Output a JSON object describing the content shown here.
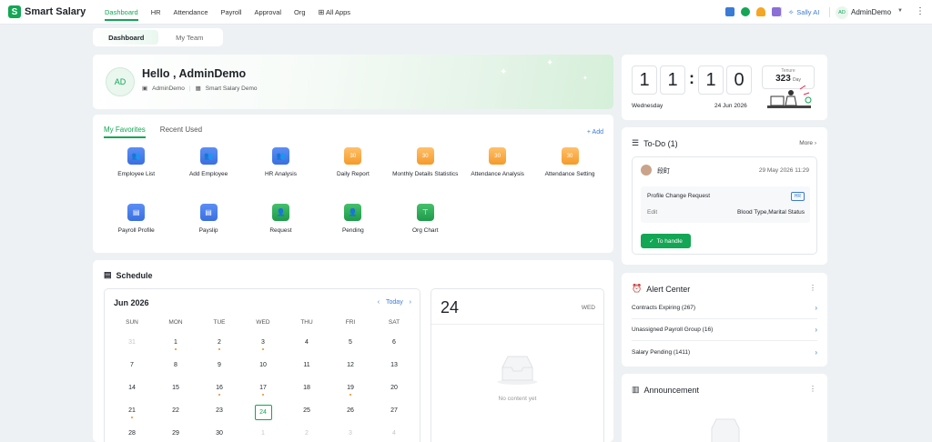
{
  "app": {
    "title": "Smart Salary",
    "logo": "S"
  },
  "nav": [
    {
      "label": "Dashboard",
      "active": true
    },
    {
      "label": "HR",
      "active": false
    },
    {
      "label": "Attendance",
      "active": false
    },
    {
      "label": "Payroll",
      "active": false
    },
    {
      "label": "Approval",
      "active": false
    },
    {
      "label": "Org",
      "active": false
    },
    {
      "label": "All Apps",
      "active": false
    }
  ],
  "topbar": {
    "ai_label": "Sally AI",
    "user_initials": "AD",
    "user_name": "AdminDemo"
  },
  "tabs": [
    {
      "label": "Dashboard",
      "active": true
    },
    {
      "label": "My Team",
      "active": false
    }
  ],
  "hello": {
    "initials": "AD",
    "greeting": "Hello , AdminDemo",
    "user": "AdminDemo",
    "company": "Smart Salary Demo"
  },
  "favorites": {
    "tabs": [
      "My Favorites",
      "Recent Used"
    ],
    "add_label": "Add",
    "items": [
      {
        "label": "Employee List",
        "color": "blue",
        "icon": "users-icon"
      },
      {
        "label": "Add Employee",
        "color": "blue",
        "icon": "users-icon"
      },
      {
        "label": "HR Analysis",
        "color": "blue",
        "icon": "users-icon"
      },
      {
        "label": "Daily Report",
        "color": "orange",
        "icon": "calendar-icon"
      },
      {
        "label": "Monthly Details Statistics",
        "color": "orange",
        "icon": "calendar-icon"
      },
      {
        "label": "Attendance Analysis",
        "color": "orange",
        "icon": "calendar-icon"
      },
      {
        "label": "Attendance Setting",
        "color": "orange",
        "icon": "calendar-icon"
      },
      {
        "label": "Payroll Profile",
        "color": "blue",
        "icon": "document-icon"
      },
      {
        "label": "Payslip",
        "color": "blue",
        "icon": "document-icon"
      },
      {
        "label": "Request",
        "color": "green",
        "icon": "person-icon"
      },
      {
        "label": "Pending",
        "color": "green",
        "icon": "person-icon"
      },
      {
        "label": "Org Chart",
        "color": "green",
        "icon": "org-chart-icon"
      }
    ]
  },
  "schedule": {
    "title": "Schedule",
    "month": "Jun 2026",
    "today_label": "Today",
    "weekdays": [
      "SUN",
      "MON",
      "TUE",
      "WED",
      "THU",
      "FRI",
      "SAT"
    ],
    "days": [
      {
        "d": "31",
        "muted": true
      },
      {
        "d": "1",
        "dot": true
      },
      {
        "d": "2",
        "dot": true
      },
      {
        "d": "3",
        "dot": true
      },
      {
        "d": "4"
      },
      {
        "d": "5"
      },
      {
        "d": "6"
      },
      {
        "d": "7"
      },
      {
        "d": "8"
      },
      {
        "d": "9"
      },
      {
        "d": "10"
      },
      {
        "d": "11"
      },
      {
        "d": "12"
      },
      {
        "d": "13"
      },
      {
        "d": "14"
      },
      {
        "d": "15"
      },
      {
        "d": "16",
        "dot": true
      },
      {
        "d": "17",
        "dot": true
      },
      {
        "d": "18"
      },
      {
        "d": "19",
        "dot": true
      },
      {
        "d": "20"
      },
      {
        "d": "21",
        "dot": true
      },
      {
        "d": "22"
      },
      {
        "d": "23"
      },
      {
        "d": "24",
        "today": true
      },
      {
        "d": "25"
      },
      {
        "d": "26"
      },
      {
        "d": "27"
      },
      {
        "d": "28"
      },
      {
        "d": "29"
      },
      {
        "d": "30"
      },
      {
        "d": "1",
        "muted": true
      },
      {
        "d": "2",
        "muted": true
      },
      {
        "d": "3",
        "muted": true
      },
      {
        "d": "4",
        "muted": true
      }
    ],
    "selected_day": "24",
    "selected_weekday": "WED",
    "empty_text": "No content yet"
  },
  "clock": {
    "digits": [
      "1",
      "1",
      "1",
      "0"
    ],
    "weekday": "Wednesday",
    "date": "24 Jun 2026",
    "tenure_label": "Tenure",
    "tenure_value": "323",
    "tenure_unit": "Day"
  },
  "todo": {
    "title": "To-Do (1)",
    "more_label": "More",
    "name": "段町",
    "date": "29 May 2026 11:29",
    "request_title": "Profile Change Request",
    "badge": "HR",
    "edit_label": "Edit",
    "edit_value": "Blood Type,Marital Status",
    "handle_label": "To handle"
  },
  "alerts": {
    "title": "Alert Center",
    "items": [
      "Contracts Expiring (267)",
      "Unassigned Payroll Group (16)",
      "Salary Pending (1411)"
    ]
  },
  "announcement": {
    "title": "Announcement"
  },
  "colors": {
    "accent": "#13a654",
    "link": "#3a7bd5",
    "dot": "#f08a1c"
  }
}
